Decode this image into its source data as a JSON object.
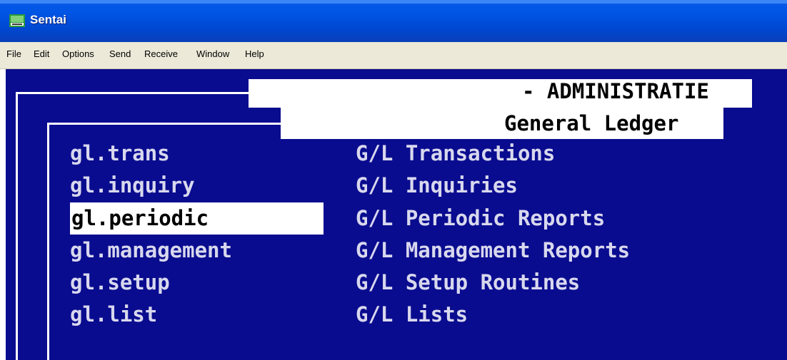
{
  "window": {
    "title": "Sentai"
  },
  "menu": {
    "items": [
      "File",
      "Edit",
      "Options",
      "Send",
      "Receive",
      "Window",
      "Help"
    ]
  },
  "screen": {
    "header_line1": "- ADMINISTRATIE",
    "header_line2": "General Ledger",
    "selected_index": 2,
    "entries": [
      {
        "command": "gl.trans",
        "description": "G/L Transactions"
      },
      {
        "command": "gl.inquiry",
        "description": "G/L Inquiries"
      },
      {
        "command": "gl.periodic",
        "description": "G/L Periodic Reports"
      },
      {
        "command": "gl.management",
        "description": "G/L Management Reports"
      },
      {
        "command": "gl.setup",
        "description": "G/L Setup Routines"
      },
      {
        "command": "gl.list",
        "description": "G/L Lists"
      }
    ]
  },
  "colors": {
    "terminal_background": "#0a0c8f",
    "terminal_text": "#d8d8ee",
    "highlight": "#ffffff",
    "titlebar": "#0055e5",
    "menubar": "#ece9d8"
  }
}
